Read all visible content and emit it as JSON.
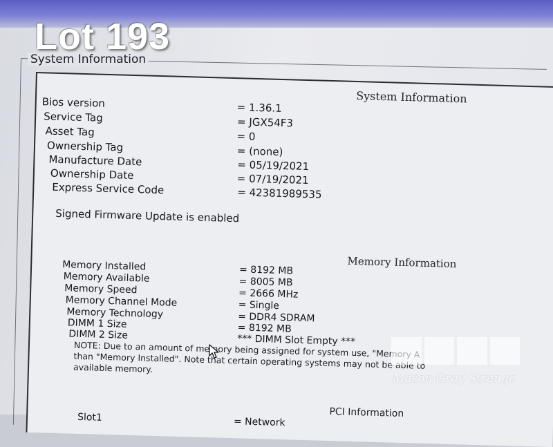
{
  "photo": {
    "lot_label": "Lot 193"
  },
  "group_box": {
    "title": "System Information"
  },
  "system": {
    "heading": "System Information",
    "rows": [
      {
        "label": "Bios version",
        "value": "= 1.36.1"
      },
      {
        "label": "Service Tag",
        "value": "= JGX54F3"
      },
      {
        "label": "Asset Tag",
        "value": "= 0"
      },
      {
        "label": "Ownership Tag",
        "value": "= (none)"
      },
      {
        "label": "Manufacture Date",
        "value": "= 05/19/2021"
      },
      {
        "label": "Ownership Date",
        "value": "= 07/19/2021"
      },
      {
        "label": "Express Service Code",
        "value": "= 42381989535"
      }
    ],
    "firmware_notice": "Signed Firmware Update is enabled"
  },
  "memory": {
    "heading": "Memory Information",
    "rows": [
      {
        "label": "Memory Installed",
        "value": "= 8192 MB"
      },
      {
        "label": "Memory Available",
        "value": "= 8005 MB"
      },
      {
        "label": "Memory Speed",
        "value": "= 2666 MHz"
      },
      {
        "label": "Memory Channel Mode",
        "value": "= Single"
      },
      {
        "label": "Memory Technology",
        "value": "= DDR4 SDRAM"
      },
      {
        "label": "DIMM 1 Size",
        "value": "= 8192 MB"
      },
      {
        "label": "DIMM 2 Size",
        "value": "*** DIMM Slot Empty ***"
      }
    ],
    "note_lines": [
      "NOTE: Due to an amount of memory being assigned for system use, \"Memory A",
      "than \"Memory Installed\". Note that certain operating systems may not be able to",
      "available memory."
    ]
  },
  "pci": {
    "heading": "PCI Information",
    "rows": [
      {
        "label": "Slot1",
        "value": "= Network"
      }
    ]
  },
  "watermark": {
    "caption": "Mason Gray Strange"
  }
}
